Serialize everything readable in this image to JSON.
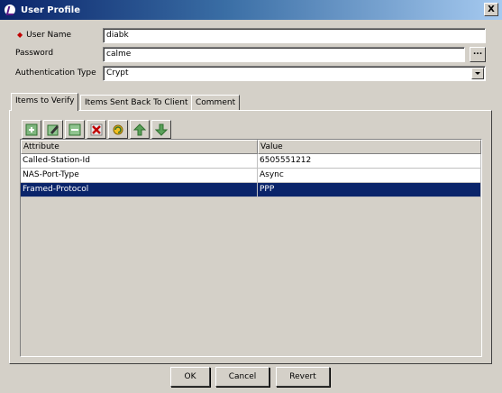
{
  "window": {
    "title": "User Profile",
    "close_glyph": "X"
  },
  "form": {
    "username_label": "User Name",
    "username_value": "diabk",
    "password_label": "Password",
    "password_value": "calme",
    "password_button": "...",
    "auth_label": "Authentication Type",
    "auth_value": "Crypt"
  },
  "tabs": [
    {
      "label": "Items to Verify",
      "active": true
    },
    {
      "label": "Items Sent Back To Client",
      "active": false
    },
    {
      "label": "Comment",
      "active": false
    }
  ],
  "toolbar": {
    "icons": [
      "add-item-icon",
      "edit-item-icon",
      "item-icon",
      "delete-item-icon",
      "refresh-icon",
      "move-up-icon",
      "move-down-icon"
    ]
  },
  "table": {
    "headers": [
      "Attribute",
      "Value"
    ],
    "rows": [
      {
        "attribute": "Called-Station-Id",
        "value": "6505551212",
        "selected": false
      },
      {
        "attribute": "NAS-Port-Type",
        "value": "Async",
        "selected": false
      },
      {
        "attribute": "Framed-Protocol",
        "value": "PPP",
        "selected": true
      }
    ]
  },
  "buttons": {
    "ok": "OK",
    "cancel": "Cancel",
    "revert": "Revert"
  },
  "colors": {
    "title_start": "#0a246a",
    "title_end": "#a6caf0",
    "selection": "#0a246a",
    "required": "#c00000"
  }
}
